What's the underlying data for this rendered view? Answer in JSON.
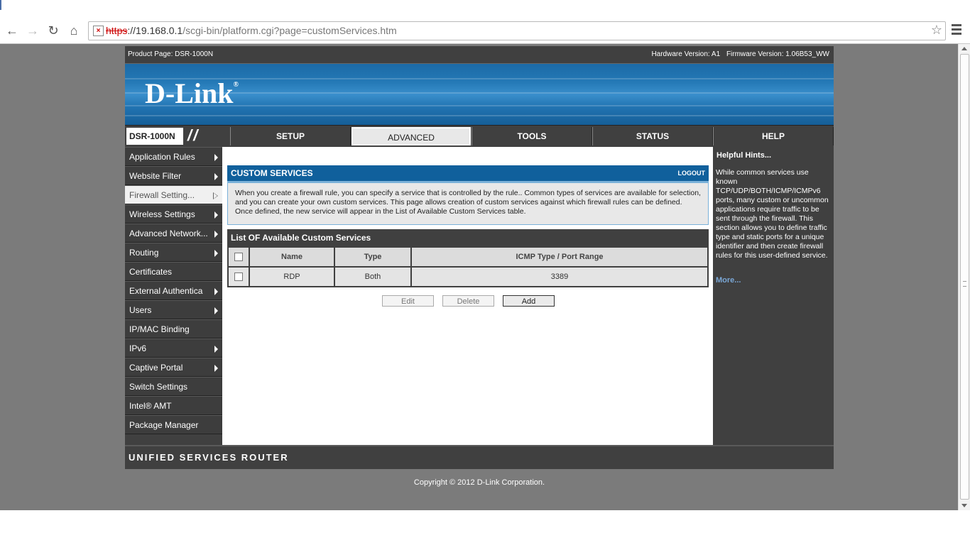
{
  "browser": {
    "url_scheme": "https",
    "url_rest": "://19.168.0.1",
    "url_path": "/scgi-bin/platform.cgi?page=customServices.htm"
  },
  "topbar": {
    "product": "Product Page: DSR-1000N",
    "hardware": "Hardware Version: A1",
    "firmware": "Firmware Version: 1.06B53_WW"
  },
  "banner": {
    "logo": "D-Link",
    "logo_mark": "®"
  },
  "nav": {
    "model": "DSR-1000N",
    "tabs": [
      {
        "label": "SETUP"
      },
      {
        "label": "ADVANCED"
      },
      {
        "label": "TOOLS"
      },
      {
        "label": "STATUS"
      },
      {
        "label": "HELP"
      }
    ],
    "active": "ADVANCED"
  },
  "sidebar": {
    "items": [
      {
        "label": "Application Rules"
      },
      {
        "label": "Website Filter"
      },
      {
        "label": "Firewall Setting..."
      },
      {
        "label": "Wireless Settings"
      },
      {
        "label": "Advanced Network..."
      },
      {
        "label": "Routing"
      },
      {
        "label": "Certificates"
      },
      {
        "label": "External Authentica"
      },
      {
        "label": "Users"
      },
      {
        "label": "IP/MAC Binding"
      },
      {
        "label": "IPv6"
      },
      {
        "label": "Captive Portal"
      },
      {
        "label": "Switch Settings"
      },
      {
        "label": "Intel® AMT"
      },
      {
        "label": "Package Manager"
      }
    ],
    "selected": "Firewall Setting..."
  },
  "main": {
    "section_title": "CUSTOM SERVICES",
    "logout": "LOGOUT",
    "description": "When you create a firewall rule, you can specify a service that is controlled by the rule.. Common types of services are available for selection, and you can create your own custom services. This page allows creation of custom services against which firewall rules can be defined. Once defined, the new service will appear in the List of Available Custom Services table.",
    "list_title": "List OF Available Custom Services",
    "table": {
      "headers": [
        "Name",
        "Type",
        "ICMP Type / Port Range"
      ],
      "rows": [
        {
          "name": "RDP",
          "type": "Both",
          "range": "3389"
        }
      ]
    },
    "buttons": {
      "edit": "Edit",
      "delete": "Delete",
      "add": "Add"
    }
  },
  "hints": {
    "title": "Helpful Hints...",
    "text": "While common services use known TCP/UDP/BOTH/ICMP/ICMPv6 ports, many custom or uncommon applications require traffic to be sent through the firewall. This section allows you to define traffic type and static ports for a unique identifier and then create firewall rules for this user-defined service.",
    "more": "More..."
  },
  "footer": {
    "product_line": "UNIFIED SERVICES ROUTER",
    "copyright": "Copyright © 2012 D-Link Corporation."
  }
}
